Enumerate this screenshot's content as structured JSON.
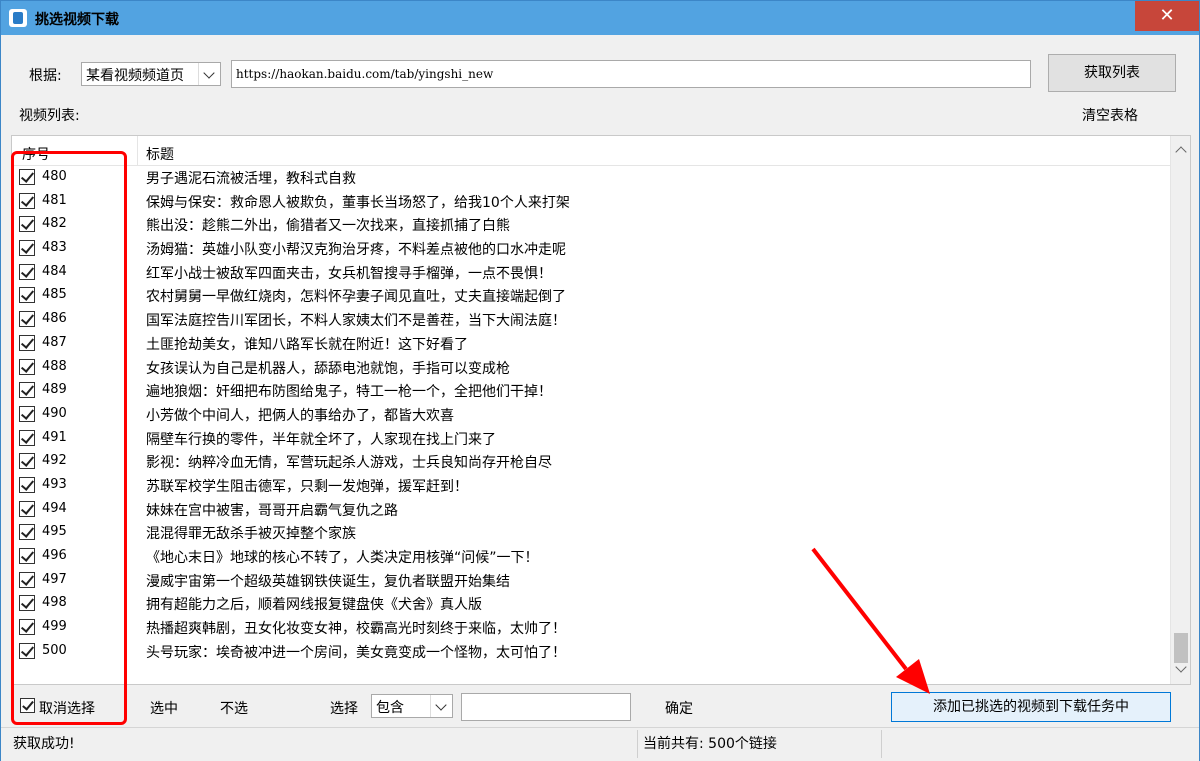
{
  "window": {
    "title": "挑选视频下载",
    "close_icon": "close-icon",
    "close_glyph": "✕"
  },
  "source": {
    "label": "根据:",
    "selected": "某看视频频道页",
    "url": "https://haokan.baidu.com/tab/yingshi_new"
  },
  "buttons": {
    "fetch_list": "获取列表",
    "clear_table": "清空表格"
  },
  "list": {
    "label": "视频列表:",
    "columns": [
      "序号",
      "标题"
    ],
    "rows": [
      {
        "num": "480",
        "title": "男子遇泥石流被活埋，教科式自救",
        "checked": true
      },
      {
        "num": "481",
        "title": "保姆与保安：救命恩人被欺负，董事长当场怒了，给我10个人来打架",
        "checked": true
      },
      {
        "num": "482",
        "title": "熊出没：趁熊二外出，偷猎者又一次找来，直接抓捕了白熊",
        "checked": true
      },
      {
        "num": "483",
        "title": "汤姆猫：英雄小队变小帮汉克狗治牙疼，不料差点被他的口水冲走呢",
        "checked": true
      },
      {
        "num": "484",
        "title": "红军小战士被敌军四面夹击，女兵机智搜寻手榴弹，一点不畏惧！",
        "checked": true
      },
      {
        "num": "485",
        "title": "农村舅舅一早做红烧肉，怎料怀孕妻子闻见直吐，丈夫直接端起倒了",
        "checked": true
      },
      {
        "num": "486",
        "title": "国军法庭控告川军团长，不料人家姨太们不是善茬，当下大闹法庭！",
        "checked": true
      },
      {
        "num": "487",
        "title": "土匪抢劫美女，谁知八路军长就在附近！这下好看了",
        "checked": true
      },
      {
        "num": "488",
        "title": "女孩误认为自己是机器人，舔舔电池就饱，手指可以变成枪",
        "checked": true
      },
      {
        "num": "489",
        "title": "遍地狼烟：奸细把布防图给鬼子，特工一枪一个，全把他们干掉！",
        "checked": true
      },
      {
        "num": "490",
        "title": "小芳做个中间人，把俩人的事给办了，都皆大欢喜",
        "checked": true
      },
      {
        "num": "491",
        "title": "隔壁车行换的零件，半年就全坏了，人家现在找上门来了",
        "checked": true
      },
      {
        "num": "492",
        "title": "影视：纳粹冷血无情，军营玩起杀人游戏，士兵良知尚存开枪自尽",
        "checked": true
      },
      {
        "num": "493",
        "title": "苏联军校学生阻击德军，只剩一发炮弹，援军赶到！",
        "checked": true
      },
      {
        "num": "494",
        "title": "妹妹在宫中被害，哥哥开启霸气复仇之路",
        "checked": true
      },
      {
        "num": "495",
        "title": "混混得罪无敌杀手被灭掉整个家族",
        "checked": true
      },
      {
        "num": "496",
        "title": "《地心末日》地球的核心不转了，人类决定用核弹“问候”一下！",
        "checked": true
      },
      {
        "num": "497",
        "title": "漫威宇宙第一个超级英雄钢铁侠诞生，复仇者联盟开始集结",
        "checked": true
      },
      {
        "num": "498",
        "title": "拥有超能力之后，顺着网线报复键盘侠《犬舍》真人版",
        "checked": true
      },
      {
        "num": "499",
        "title": "热播超爽韩剧，丑女化妆变女神，校霸高光时刻终于来临，太帅了！",
        "checked": true
      },
      {
        "num": "500",
        "title": "头号玩家：埃奇被冲进一个房间，美女竟变成一个怪物，太可怕了！",
        "checked": true
      }
    ]
  },
  "bottom": {
    "cancel_select": "取消选择",
    "select": "选中",
    "deselect": "不选",
    "choose_label": "选择",
    "match_mode": "包含",
    "confirm": "确定",
    "add_to_tasks": "添加已挑选的视频到下载任务中"
  },
  "status": {
    "left": "获取成功!",
    "right": "当前共有: 500个链接"
  },
  "colors": {
    "titlebar": "#52a3e1",
    "close": "#c7463a",
    "highlight": "#ff0000"
  }
}
